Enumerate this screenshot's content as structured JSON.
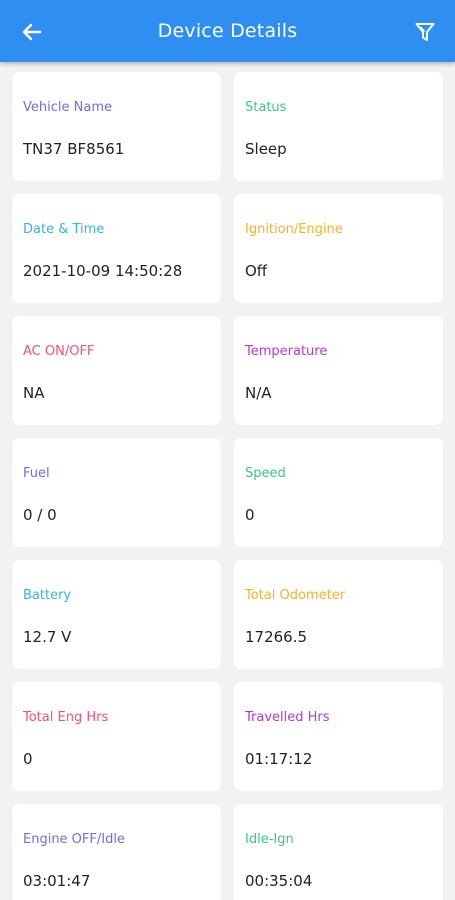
{
  "header": {
    "title": "Device Details",
    "back_icon": "arrow-left-icon",
    "filter_icon": "filter-icon",
    "bar_color": "#2f8ef2"
  },
  "details": [
    {
      "label": "Vehicle Name",
      "value": "TN37 BF8561",
      "color": "#6b6fe6"
    },
    {
      "label": "Status",
      "value": "Sleep",
      "color": "#3cc48b"
    },
    {
      "label": "Date & Time",
      "value": "2021-10-09 14:50:28",
      "color": "#39b3e0"
    },
    {
      "label": "Ignition/Engine",
      "value": "Off",
      "color": "#f4b12a"
    },
    {
      "label": "AC ON/OFF",
      "value": "NA",
      "color": "#f0517a"
    },
    {
      "label": "Temperature",
      "value": "N/A",
      "color": "#b43ad4"
    },
    {
      "label": "Fuel",
      "value": "0 / 0",
      "color": "#6b6fe6"
    },
    {
      "label": "Speed",
      "value": "0",
      "color": "#3cc48b"
    },
    {
      "label": "Battery",
      "value": "12.7 V",
      "color": "#39b3e0"
    },
    {
      "label": "Total Odometer",
      "value": "17266.5",
      "color": "#f4b12a"
    },
    {
      "label": "Total Eng Hrs",
      "value": "0",
      "color": "#f0517a"
    },
    {
      "label": "Travelled Hrs",
      "value": "01:17:12",
      "color": "#b43ad4"
    },
    {
      "label": "Engine OFF/Idle",
      "value": "03:01:47",
      "color": "#6b6fe6"
    },
    {
      "label": "Idle-Ign",
      "value": "00:35:04",
      "color": "#3cc48b"
    }
  ]
}
